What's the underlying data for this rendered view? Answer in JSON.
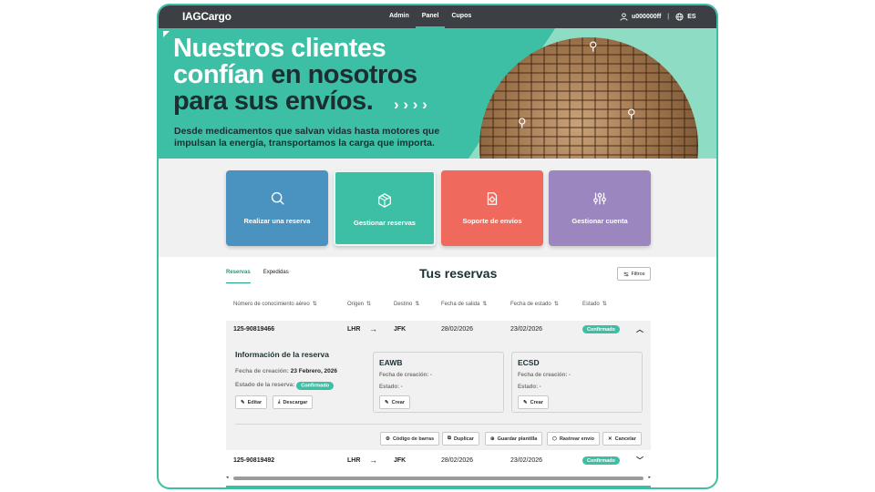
{
  "app": {
    "logo": "IAGCargo"
  },
  "nav": [
    {
      "label": "Admin"
    },
    {
      "label": "Panel"
    },
    {
      "label": "Cupos"
    }
  ],
  "user": {
    "id": "u000000ff",
    "lang": "ES"
  },
  "hero": {
    "line1": "Nuestros clientes",
    "line2a": "confían",
    "line2b": "en nosotros",
    "line3": "para sus envíos.",
    "chevrons": "› › › ›",
    "subtitle": "Desde medicamentos que salvan vidas hasta motores que impulsan la energía, transportamos la carga que importa."
  },
  "cards": [
    {
      "label": "Realizar una reserva",
      "icon": "search-icon",
      "color": "#4a93c0"
    },
    {
      "label": "Gestionar reservas",
      "icon": "box-icon",
      "color": "#3dbfa5"
    },
    {
      "label": "Soporte de envíos",
      "icon": "support-gear-icon",
      "color": "#ef6a5c"
    },
    {
      "label": "Gestionar cuenta",
      "icon": "sliders-icon",
      "color": "#9b86c0"
    }
  ],
  "reservas": {
    "title": "Tus reservas",
    "tabs": [
      {
        "label": "Reservas"
      },
      {
        "label": "Expedidas"
      }
    ],
    "filters_label": "Filtros",
    "columns": [
      "Número de conocimiento aéreo",
      "Origen",
      "Destino",
      "Fecha de salida",
      "Fecha de estado",
      "Estado"
    ],
    "rows": [
      {
        "awb": "125-90819466",
        "origin": "LHR",
        "dest": "JFK",
        "departure": "28/02/2026",
        "status_date": "23/02/2026",
        "status": "Confirmado"
      },
      {
        "awb": "125-90819492",
        "origin": "LHR",
        "dest": "JFK",
        "departure": "28/02/2026",
        "status_date": "23/02/2026",
        "status": "Confirmado"
      }
    ],
    "detail": {
      "title": "Información de la reserva",
      "created_label": "Fecha de creación:",
      "created_value": "23 Febrero, 2026",
      "state_label": "Estado de la reserva:",
      "state_value": "Confirmado",
      "edit": "Editar",
      "download": "Descargar",
      "boxes": [
        {
          "title": "EAWB",
          "created": "Fecha de creación: -",
          "state": "Estado: -",
          "action": "Crear"
        },
        {
          "title": "ECSD",
          "created": "Fecha de creación: -",
          "state": "Estado: -",
          "action": "Crear"
        }
      ],
      "actions": [
        "Código de barras",
        "Duplicar",
        "Guardar plantilla",
        "Rastrear envío",
        "Cancelar"
      ]
    }
  }
}
